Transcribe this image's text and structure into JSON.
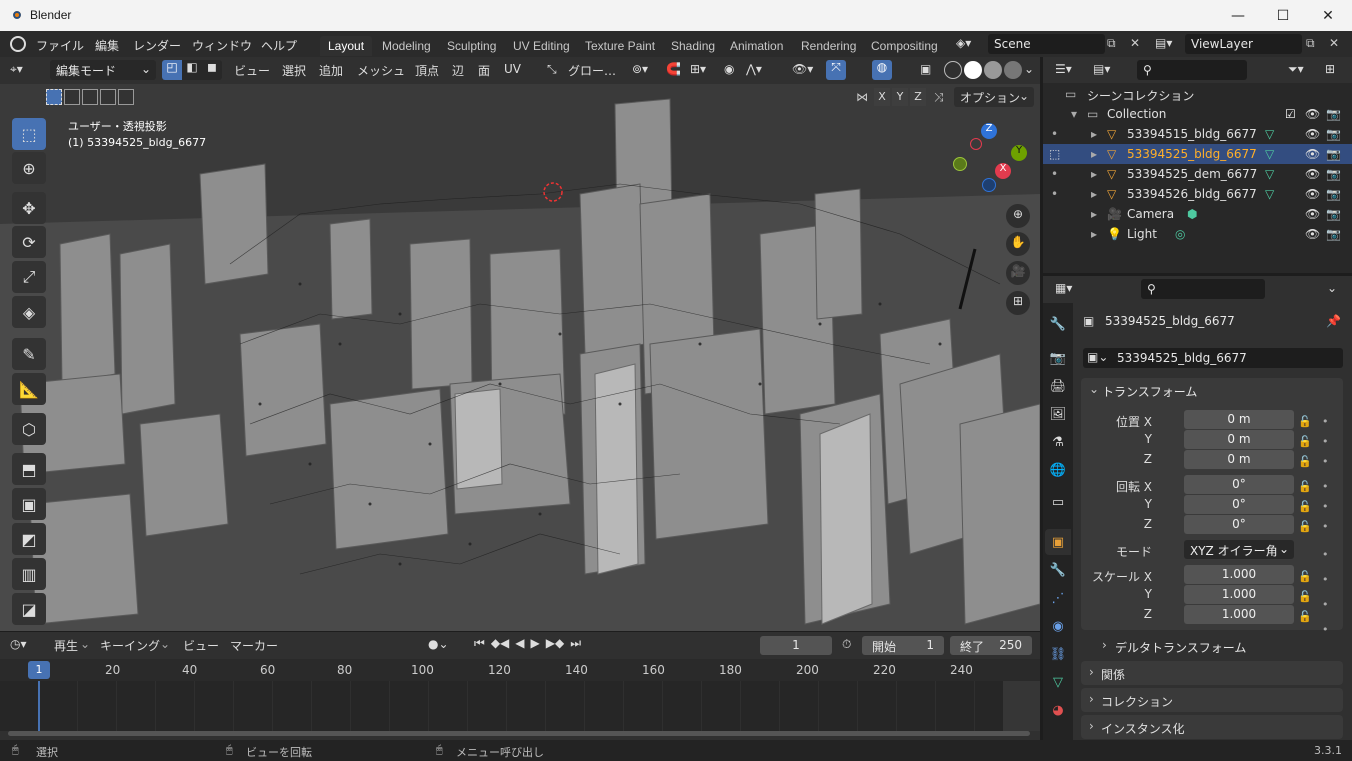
{
  "window": {
    "title": "Blender",
    "minimize": "—",
    "maximize": "☐",
    "close": "✕"
  },
  "menu": {
    "items": [
      "ファイル",
      "編集",
      "レンダー",
      "ウィンドウ",
      "ヘルプ"
    ]
  },
  "workspaces": {
    "tabs": [
      "Layout",
      "Modeling",
      "Sculpting",
      "UV Editing",
      "Texture Paint",
      "Shading",
      "Animation",
      "Rendering",
      "Compositing"
    ],
    "active": "Layout"
  },
  "scene": {
    "name": "Scene",
    "view_layer": "ViewLayer"
  },
  "viewport_header": {
    "mode": "編集モード",
    "menus": [
      "ビュー",
      "選択",
      "追加",
      "メッシュ",
      "頂点",
      "辺",
      "面",
      "UV"
    ],
    "transform_orientation": "グロー…",
    "axes": [
      "X",
      "Y",
      "Z"
    ],
    "options": "オプション"
  },
  "viewport": {
    "view_label": "ユーザー・透視投影",
    "object_label": "(1) 53394525_bldg_6677",
    "gizmo_axes": {
      "z": "Z",
      "y": "Y",
      "x": "X"
    }
  },
  "outliner": {
    "scene_collection": "シーンコレクション",
    "collection": "Collection",
    "items": [
      {
        "name": "53394515_bldg_6677",
        "selected": false
      },
      {
        "name": "53394525_bldg_6677",
        "selected": true
      },
      {
        "name": "53394525_dem_6677",
        "selected": false
      },
      {
        "name": "53394526_bldg_6677",
        "selected": false
      },
      {
        "name": "Camera",
        "selected": false
      },
      {
        "name": "Light",
        "selected": false
      }
    ]
  },
  "properties": {
    "object_name": "53394525_bldg_6677",
    "object_datablock": "53394525_bldg_6677",
    "transform_header": "トランスフォーム",
    "location": {
      "label": "位置 X",
      "x": "0 m",
      "y": "0 m",
      "z": "0 m"
    },
    "rotation": {
      "label": "回転 X",
      "x": "0°",
      "y": "0°",
      "z": "0°"
    },
    "mode_label": "モード",
    "mode_value": "XYZ オイラー角",
    "scale": {
      "label": "スケール X",
      "x": "1.000",
      "y": "1.000",
      "z": "1.000"
    },
    "axis_y": "Y",
    "axis_z": "Z",
    "delta_transform": "デルタトランスフォーム",
    "relations": "関係",
    "collections": "コレクション",
    "instancing": "インスタンス化"
  },
  "timeline": {
    "playback": "再生",
    "keying": "キーイング",
    "view": "ビュー",
    "marker": "マーカー",
    "current_frame": "1",
    "start_label": "開始",
    "start": "1",
    "end_label": "終了",
    "end": "250",
    "ruler": [
      "1",
      "20",
      "40",
      "60",
      "80",
      "100",
      "120",
      "140",
      "160",
      "180",
      "200",
      "220",
      "240"
    ]
  },
  "statusbar": {
    "select": "選択",
    "rotate_view": "ビューを回転",
    "call_menu": "メニュー呼び出し",
    "version": "3.3.1"
  },
  "colors": {
    "accent": "#4772b3",
    "selected_text": "#ffaf29",
    "mesh_green": "#4ec9a0",
    "active_blue": "#334d80"
  }
}
